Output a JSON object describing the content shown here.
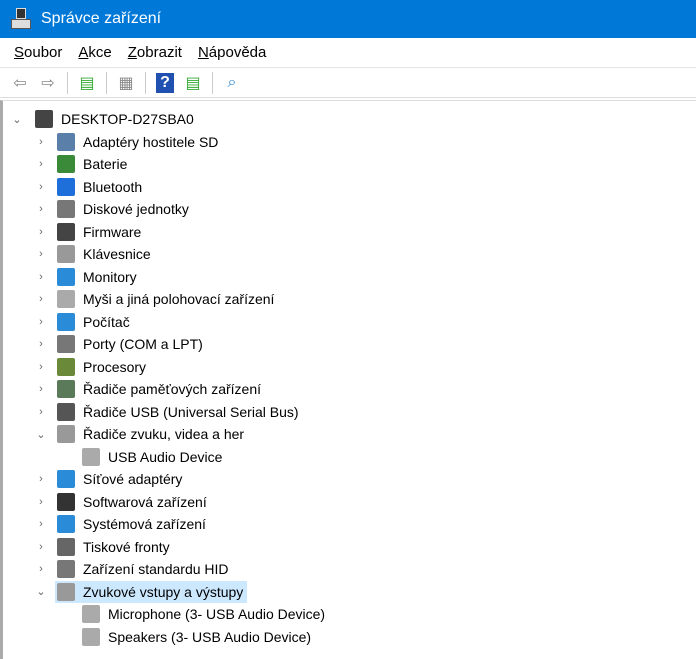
{
  "window": {
    "title": "Správce zařízení"
  },
  "menu": [
    {
      "u": "S",
      "rest": "oubor"
    },
    {
      "u": "A",
      "rest": "kce"
    },
    {
      "u": "Z",
      "rest": "obrazit"
    },
    {
      "u": "N",
      "rest": "ápověda"
    }
  ],
  "toolbar": [
    "back-icon",
    "forward-icon",
    "show-hide-console-tree-icon",
    "properties-icon",
    "help-icon",
    "show-action-pane-icon",
    "scan-hardware-icon"
  ],
  "tree": {
    "root": "DESKTOP-D27SBA0",
    "items": [
      {
        "label": "Adaptéry hostitele SD",
        "color": "#5a7fa8",
        "expanded": false
      },
      {
        "label": "Baterie",
        "color": "#3a8a3a",
        "expanded": false
      },
      {
        "label": "Bluetooth",
        "color": "#1e6fd9",
        "expanded": false
      },
      {
        "label": "Diskové jednotky",
        "color": "#777",
        "expanded": false
      },
      {
        "label": "Firmware",
        "color": "#444",
        "expanded": false
      },
      {
        "label": "Klávesnice",
        "color": "#999",
        "expanded": false
      },
      {
        "label": "Monitory",
        "color": "#2a8bd8",
        "expanded": false
      },
      {
        "label": "Myši a jiná polohovací zařízení",
        "color": "#aaa",
        "expanded": false
      },
      {
        "label": "Počítač",
        "color": "#2a8bd8",
        "expanded": false
      },
      {
        "label": "Porty (COM a LPT)",
        "color": "#777",
        "expanded": false
      },
      {
        "label": "Procesory",
        "color": "#6a8a3a",
        "expanded": false
      },
      {
        "label": "Řadiče paměťových zařízení",
        "color": "#5a7a5a",
        "expanded": false
      },
      {
        "label": "Řadiče USB (Universal Serial Bus)",
        "color": "#555",
        "expanded": false
      },
      {
        "label": "Řadiče zvuku, videa a her",
        "color": "#999",
        "expanded": true,
        "children": [
          "USB Audio Device"
        ]
      },
      {
        "label": "Síťové adaptéry",
        "color": "#2a8bd8",
        "expanded": false
      },
      {
        "label": "Softwarová zařízení",
        "color": "#333",
        "expanded": false
      },
      {
        "label": "Systémová zařízení",
        "color": "#2a8bd8",
        "expanded": false
      },
      {
        "label": "Tiskové fronty",
        "color": "#666",
        "expanded": false
      },
      {
        "label": "Zařízení standardu HID",
        "color": "#777",
        "expanded": false
      },
      {
        "label": "Zvukové vstupy a výstupy",
        "color": "#999",
        "expanded": true,
        "selected": true,
        "children": [
          "Microphone (3- USB Audio Device)",
          "Speakers (3- USB Audio Device)"
        ]
      }
    ]
  }
}
